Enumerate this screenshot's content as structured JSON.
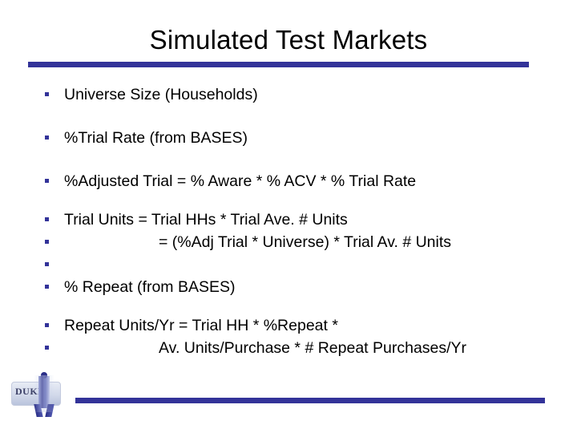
{
  "slide": {
    "title": "Simulated Test Markets",
    "accent_color": "#333399",
    "text_color": "#000000",
    "background_color": "#ffffff",
    "bullets": [
      {
        "text": "Universe Size (Households)",
        "indent": false,
        "bullet": true
      },
      {
        "text": "%Trial Rate (from BASES)",
        "indent": false,
        "bullet": true
      },
      {
        "text": "%Adjusted Trial = % Aware * % ACV * % Trial Rate",
        "indent": false,
        "bullet": true
      },
      {
        "text": "Trial Units = Trial HHs * Trial Ave. # Units",
        "indent": false,
        "bullet": true
      },
      {
        "text": "= (%Adj Trial * Universe) * Trial Av. # Units",
        "indent": true,
        "bullet": true
      },
      {
        "text": "",
        "indent": false,
        "bullet": true
      },
      {
        "text": "% Repeat (from BASES)",
        "indent": false,
        "bullet": true
      },
      {
        "text": "Repeat Units/Yr = Trial HH * %Repeat *",
        "indent": false,
        "bullet": true
      },
      {
        "text": "Av. Units/Purchase * # Repeat Purchases/Yr",
        "indent": true,
        "bullet": true
      }
    ]
  },
  "logo": {
    "wordmark": "DUKE"
  }
}
